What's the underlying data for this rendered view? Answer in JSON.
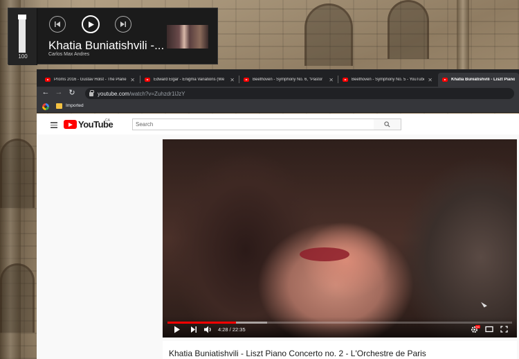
{
  "media_overlay": {
    "volume_value": "100",
    "volume_level": 1.0,
    "track_title": "Khatia Buniatishvili -...",
    "artist": "Carlos Max Andres",
    "icons": [
      "previous-track-icon",
      "play-icon",
      "next-track-icon"
    ]
  },
  "browser": {
    "tabs": [
      {
        "label": "Proms 2016 - Gustav Holst - The Plane",
        "active": false
      },
      {
        "label": "Edward Elgar - Enigma Variations (We",
        "active": false
      },
      {
        "label": "Beethoven - Symphony No. 6, \"Pastor",
        "active": false
      },
      {
        "label": "Beethoven - Symphony No. 5 - YouTube",
        "active": false
      },
      {
        "label": "Khatia Buniatishvili - Liszt Piano Co",
        "active": true
      }
    ],
    "url_domain": "youtube.com",
    "url_path": "/watch?v=Zuhzdr1lJzY",
    "bookmark_label": "Imported"
  },
  "youtube": {
    "logo_text": "YouTube",
    "country": "CA",
    "search_placeholder": "Search",
    "player": {
      "current_time": "4:28",
      "duration": "22:35",
      "time_display": "4:28 / 22:35",
      "played_fraction": 0.198,
      "buffered_fraction": 0.29
    },
    "cc_badge": "HD",
    "video_title": "Khatia Buniatishvili - Liszt Piano Concerto no. 2 - L'Orchestre de Paris"
  },
  "colors": {
    "youtube_red": "#ff0000",
    "chrome_dark": "#202124",
    "chrome_toolbar": "#35363a"
  }
}
